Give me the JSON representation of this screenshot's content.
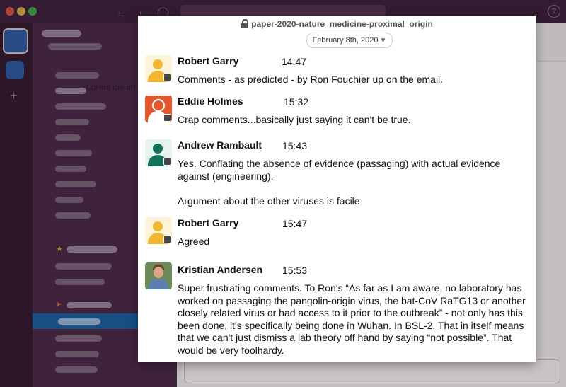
{
  "background": {
    "lorem_text": "Lorem ipsum"
  },
  "card": {
    "title": "paper-2020-nature_medicine-proximal_origin",
    "date": "February 8th, 2020",
    "messages": [
      {
        "sender": "Robert Garry",
        "time": "14:47",
        "text": "Comments - as predicted - by Ron Fouchier up on the email.",
        "avatar": "yellow-person-icon"
      },
      {
        "sender": "Eddie Holmes",
        "time": "15:32",
        "text": "Crap comments...basically just saying it can't be true.",
        "avatar": "orange-person-icon"
      },
      {
        "sender": "Andrew Rambault",
        "time": "15:43",
        "text": "Yes. Conflating the absence of evidence (passaging) with actual evidence against (engineering).\n\nArgument about the other viruses is facile",
        "avatar": "green-person-icon"
      },
      {
        "sender": "Robert Garry",
        "time": "15:47",
        "text": "Agreed",
        "avatar": "yellow-person-icon"
      },
      {
        "sender": "Kristian Andersen",
        "time": "15:53",
        "text": "Super frustrating comments. To Ron's “As far as I am aware, no laboratory has worked on passaging the pangolin-origin virus, the bat-CoV RaTG13 or another closely related virus or had access to it prior to the outbreak” - not only has this been done, it's specifically being done in Wuhan. In BSL-2. That in itself means that we can't just dismiss a lab theory off hand by saying “not possible”. That would be very foolhardy.",
        "avatar": "photo-avatar"
      }
    ]
  }
}
